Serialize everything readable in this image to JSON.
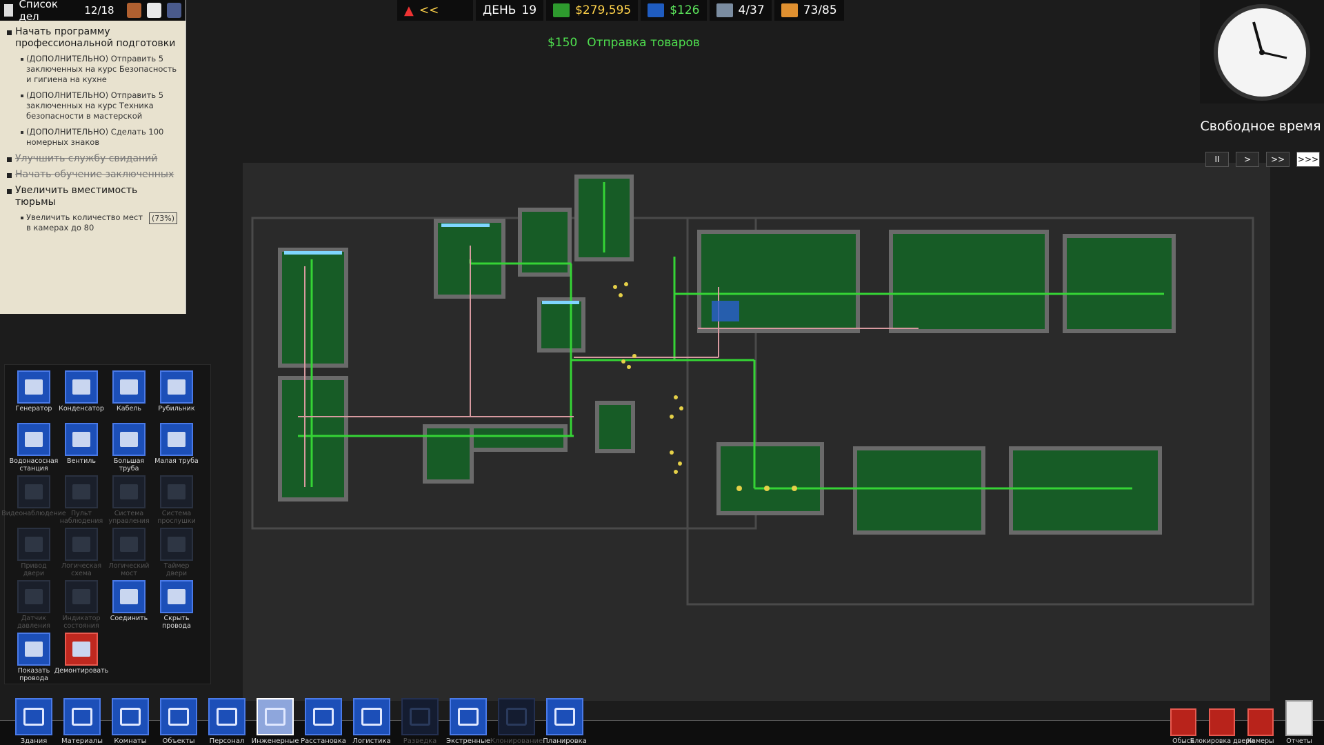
{
  "todo": {
    "title": "Список дел",
    "count": "12/18",
    "items": [
      {
        "label": "Начать программу профессиональной подготовки",
        "done": false
      },
      {
        "label": "Улучшить службу свиданий",
        "done": true
      },
      {
        "label": "Начать обучение заключенных",
        "done": true
      },
      {
        "label": "Увеличить вместимость тюрьмы",
        "done": false
      }
    ],
    "subs_training": [
      "(ДОПОЛНИТЕЛЬНО) Отправить 5 заключенных на курс Безопасность и гигиена на кухне",
      "(ДОПОЛНИТЕЛЬНО) Отправить 5 заключенных на курс Техника безопасности в мастерской",
      "(ДОПОЛНИТЕЛЬНО) Сделать 100 номерных знаков"
    ],
    "sub_capacity": "Увеличить количество мест в камерах до 80",
    "sub_capacity_pct": "(73%)"
  },
  "topbar": {
    "rewind": "<<",
    "day_label": "ДЕНЬ",
    "day": "19",
    "balance": "$279,595",
    "income": "$126",
    "staff": "4/37",
    "prisoners": "73/85"
  },
  "event": {
    "amount": "$150",
    "text": "Отправка товаров"
  },
  "clock": {
    "mode": "Свободное время",
    "speeds": [
      "II",
      ">",
      ">>",
      ">>>"
    ]
  },
  "palette": [
    {
      "label": "Генератор",
      "enabled": true
    },
    {
      "label": "Конденсатор",
      "enabled": true
    },
    {
      "label": "Кабель",
      "enabled": true
    },
    {
      "label": "Рубильник",
      "enabled": true
    },
    {
      "label": "Водонасосная станция",
      "enabled": true
    },
    {
      "label": "Вентиль",
      "enabled": true
    },
    {
      "label": "Большая труба",
      "enabled": true
    },
    {
      "label": "Малая труба",
      "enabled": true
    },
    {
      "label": "Видеонаблюдение",
      "enabled": false
    },
    {
      "label": "Пульт наблюдения",
      "enabled": false
    },
    {
      "label": "Система управления",
      "enabled": false
    },
    {
      "label": "Система прослушки",
      "enabled": false
    },
    {
      "label": "Привод двери",
      "enabled": false
    },
    {
      "label": "Логическая схема",
      "enabled": false
    },
    {
      "label": "Логический мост",
      "enabled": false
    },
    {
      "label": "Таймер двери",
      "enabled": false
    },
    {
      "label": "Датчик давления",
      "enabled": false
    },
    {
      "label": "Индикатор состояния",
      "enabled": false
    },
    {
      "label": "Соединить",
      "enabled": true
    },
    {
      "label": "Скрыть провода",
      "enabled": true
    },
    {
      "label": "Показать провода",
      "enabled": true
    },
    {
      "label": "Демонтировать",
      "enabled": true,
      "red": true
    }
  ],
  "toolbar": [
    {
      "label": "Здания",
      "state": "normal"
    },
    {
      "label": "Материалы",
      "state": "normal"
    },
    {
      "label": "Комнаты",
      "state": "normal"
    },
    {
      "label": "Объекты",
      "state": "normal"
    },
    {
      "label": "Персонал",
      "state": "normal"
    },
    {
      "label": "Инженерные",
      "state": "selected"
    },
    {
      "label": "Расстановка",
      "state": "normal"
    },
    {
      "label": "Логистика",
      "state": "normal"
    },
    {
      "label": "Разведка",
      "state": "disabled"
    },
    {
      "label": "Экстренные",
      "state": "normal"
    },
    {
      "label": "Клонирование",
      "state": "disabled"
    },
    {
      "label": "Планировка",
      "state": "normal"
    }
  ],
  "right_toolbar": [
    {
      "label": "Обыск"
    },
    {
      "label": "Блокировка"
    },
    {
      "label": "двери"
    },
    {
      "label": "Камеры"
    },
    {
      "label": "Отчеты"
    }
  ],
  "colors": {
    "power_line": "#35d435",
    "water_line": "#d89aa0",
    "floor": "#1e6e2e",
    "wall": "#5a5a5a",
    "ui_blue": "#1c4fb8"
  }
}
